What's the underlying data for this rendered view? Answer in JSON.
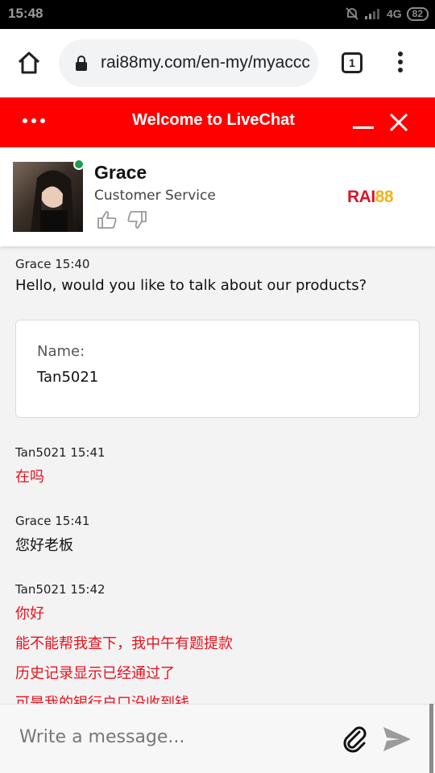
{
  "status_bar": {
    "time": "15:48",
    "network": "4G",
    "battery": "82"
  },
  "browser": {
    "url": "rai88my.com/en-my/myaccc",
    "tab_count": "1"
  },
  "chat_header": {
    "title": "Welcome to LiveChat"
  },
  "agent": {
    "name": "Grace",
    "role": "Customer Service",
    "brand_red": "RAI",
    "brand_yellow": "88",
    "online_color": "#1a9f4a"
  },
  "messages": [
    {
      "meta": "Grace 15:40",
      "lines": [
        "Hello, would you like to talk about our products?"
      ]
    },
    {
      "form_label": "Name:",
      "form_value": "Tan5021"
    },
    {
      "meta": "Tan5021 15:41",
      "lines": [
        "在吗"
      ]
    },
    {
      "meta": "Grace 15:41",
      "lines": [
        "您好老板"
      ]
    },
    {
      "meta": "Tan5021 15:42",
      "lines": [
        "你好",
        "能不能帮我查下，我中午有题提款",
        "历史记录显示已经通过了",
        "可是我的银行户口没收到钱"
      ]
    }
  ],
  "composer": {
    "placeholder": "Write a message..."
  },
  "colors": {
    "header": "#ff0000",
    "customer_text": "#e8121d",
    "brand_red": "#d7152a",
    "brand_yellow": "#f3b418"
  }
}
